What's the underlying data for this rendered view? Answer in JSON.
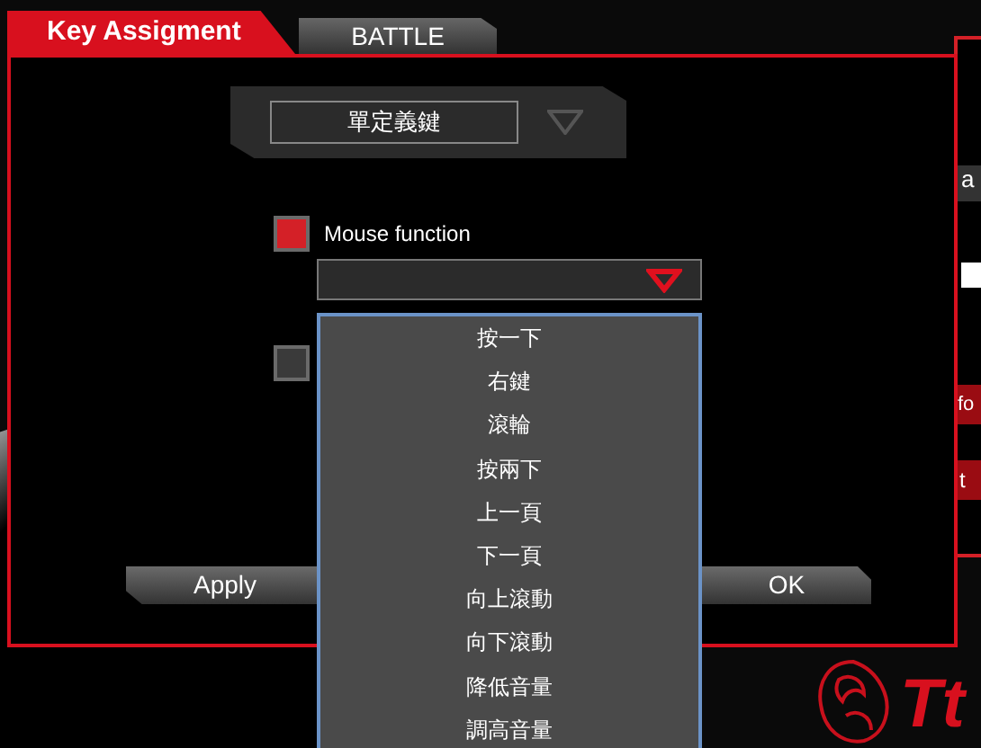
{
  "tabs": [
    {
      "label": "Key Assigment",
      "selected": true
    },
    {
      "label": "BATTLE",
      "selected": false
    }
  ],
  "mode_select": {
    "value": "單定義鍵"
  },
  "options": [
    {
      "label": "Mouse function",
      "checked": true
    },
    {
      "checked": false
    }
  ],
  "function_dropdown": {
    "expanded": true,
    "items": [
      "按一下",
      "右鍵",
      "滾輪",
      "按兩下",
      "上一頁",
      "下一頁",
      "向上滾動",
      "向下滾動",
      "降低音量",
      "調高音量"
    ]
  },
  "buttons": [
    "Apply",
    "OK"
  ],
  "side_panel": {
    "texts": [
      "a",
      "fo",
      "t"
    ]
  },
  "logo": {
    "text": "Tt"
  }
}
